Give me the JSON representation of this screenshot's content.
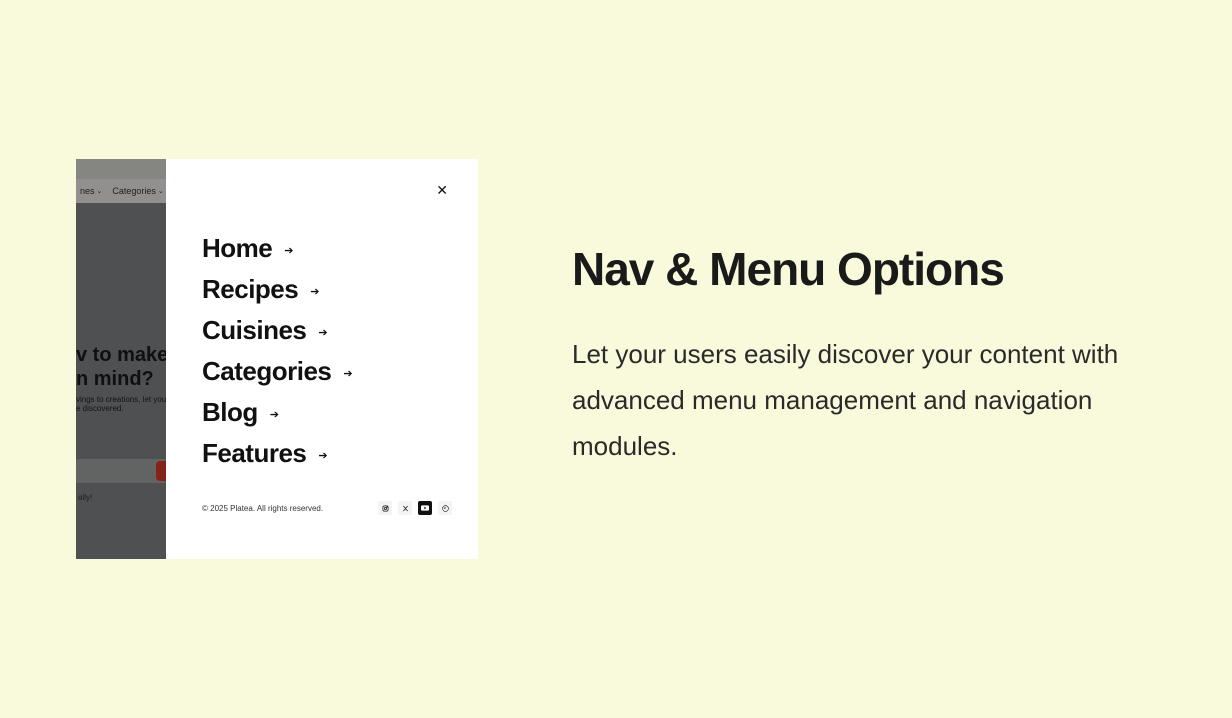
{
  "right": {
    "title": "Nav & Menu Options",
    "description": "Let your users easily discover your content with advanced menu management and navigation modules."
  },
  "shot": {
    "bg": {
      "nav_item_1": "nes",
      "nav_item_2": "Categories",
      "hero_line_1": "v to make",
      "hero_line_2": "n mind?",
      "hero_sub_1": "vings to creations, let you",
      "hero_sub_2": "e discovered.",
      "tag": "ally!"
    },
    "panel": {
      "menu": [
        {
          "label": "Home"
        },
        {
          "label": "Recipes"
        },
        {
          "label": "Cuisines"
        },
        {
          "label": "Categories"
        },
        {
          "label": "Blog"
        },
        {
          "label": "Features"
        }
      ],
      "copyright": "© 2025 Platea. All rights reserved.",
      "socials": {
        "instagram": "instagram-icon",
        "x": "x-icon",
        "youtube": "youtube-icon",
        "pinterest": "pinterest-icon"
      }
    }
  }
}
